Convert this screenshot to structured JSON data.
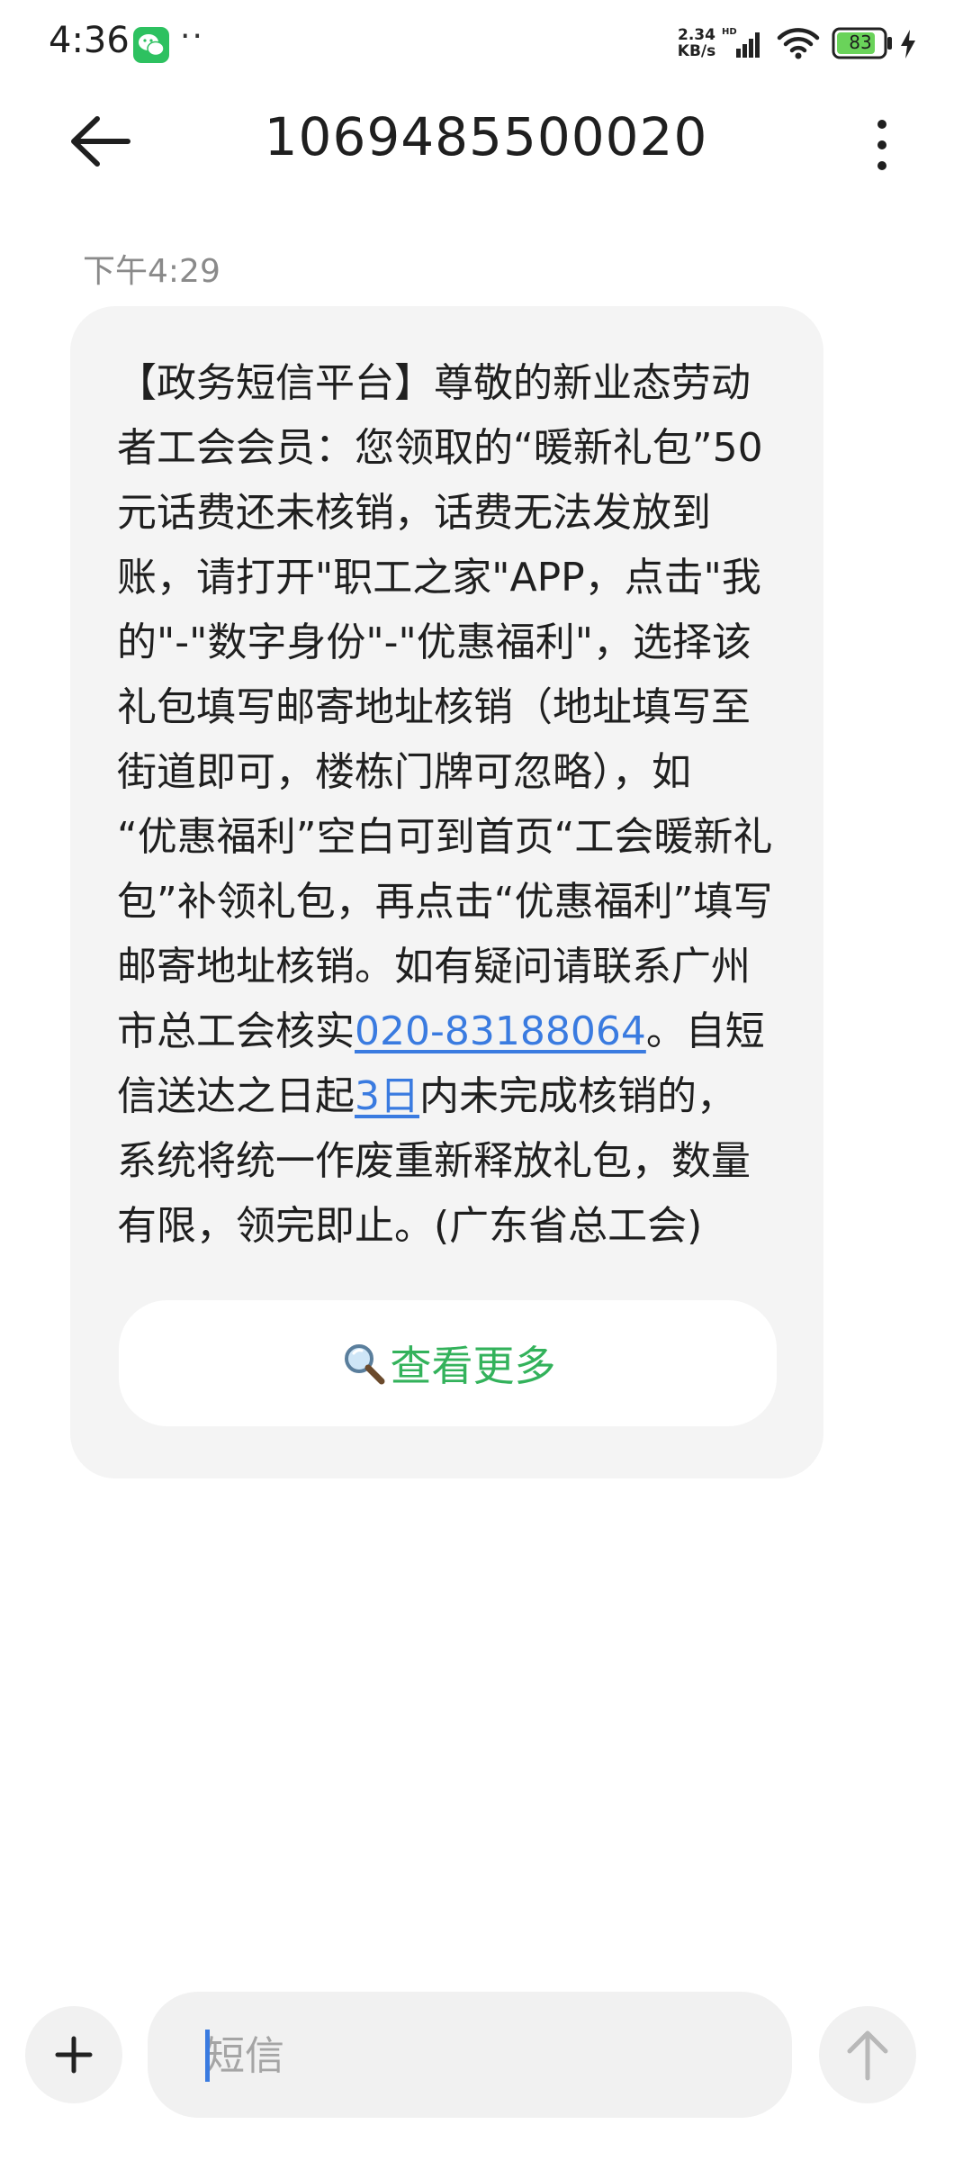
{
  "status_bar": {
    "time": "4:36",
    "dots": "··",
    "net_speed_value": "2.34",
    "net_speed_unit": "KB/s",
    "network_type": "HD",
    "battery_level": "83"
  },
  "header": {
    "title": "1069485500020"
  },
  "message": {
    "timestamp": "下午4:29",
    "lines": [
      "【政务短信平台】尊敬的新业态劳动",
      "者工会会员：您领取的“暖新礼包”50",
      "元话费还未核销，话费无法发放到",
      "账，请打开\"职工之家\"APP，点击\"我",
      "的\"-\"数字身份\"-\"优惠福利\"，选择该",
      "礼包填写邮寄地址核销（地址填写至",
      "街道即可，楼栋门牌可忽略），如",
      "“优惠福利”空白可到首页“工会暖新礼",
      "包”补领礼包，再点击“优惠福利”填写",
      "邮寄地址核销。如有疑问请联系广州"
    ],
    "line11_before_link": "市总工会核实",
    "phone_link": "020-83188064",
    "line11_after_link": "。自短",
    "line12_before_link": "信送达之日起",
    "days_link": "3日",
    "line12_after_link": "内未完成核销的，",
    "line13": "系统将统一作废重新释放礼包，数量",
    "line14": "有限，领完即止。(广东省总工会)",
    "view_more_label": "查看更多"
  },
  "compose": {
    "placeholder": "短信"
  },
  "colors": {
    "link": "#3a7be0",
    "view_more": "#33b25b",
    "bubble_bg": "#f4f4f4",
    "battery_fill": "#6ad35a"
  },
  "icons": {
    "back": "back-arrow-icon",
    "more": "more-vertical-icon",
    "search": "magnifier-icon",
    "attach": "plus-icon",
    "send": "arrow-up-icon",
    "wechat": "wechat-icon",
    "signal": "signal-icon",
    "wifi": "wifi-icon",
    "battery": "battery-icon",
    "charging": "charging-bolt-icon"
  }
}
